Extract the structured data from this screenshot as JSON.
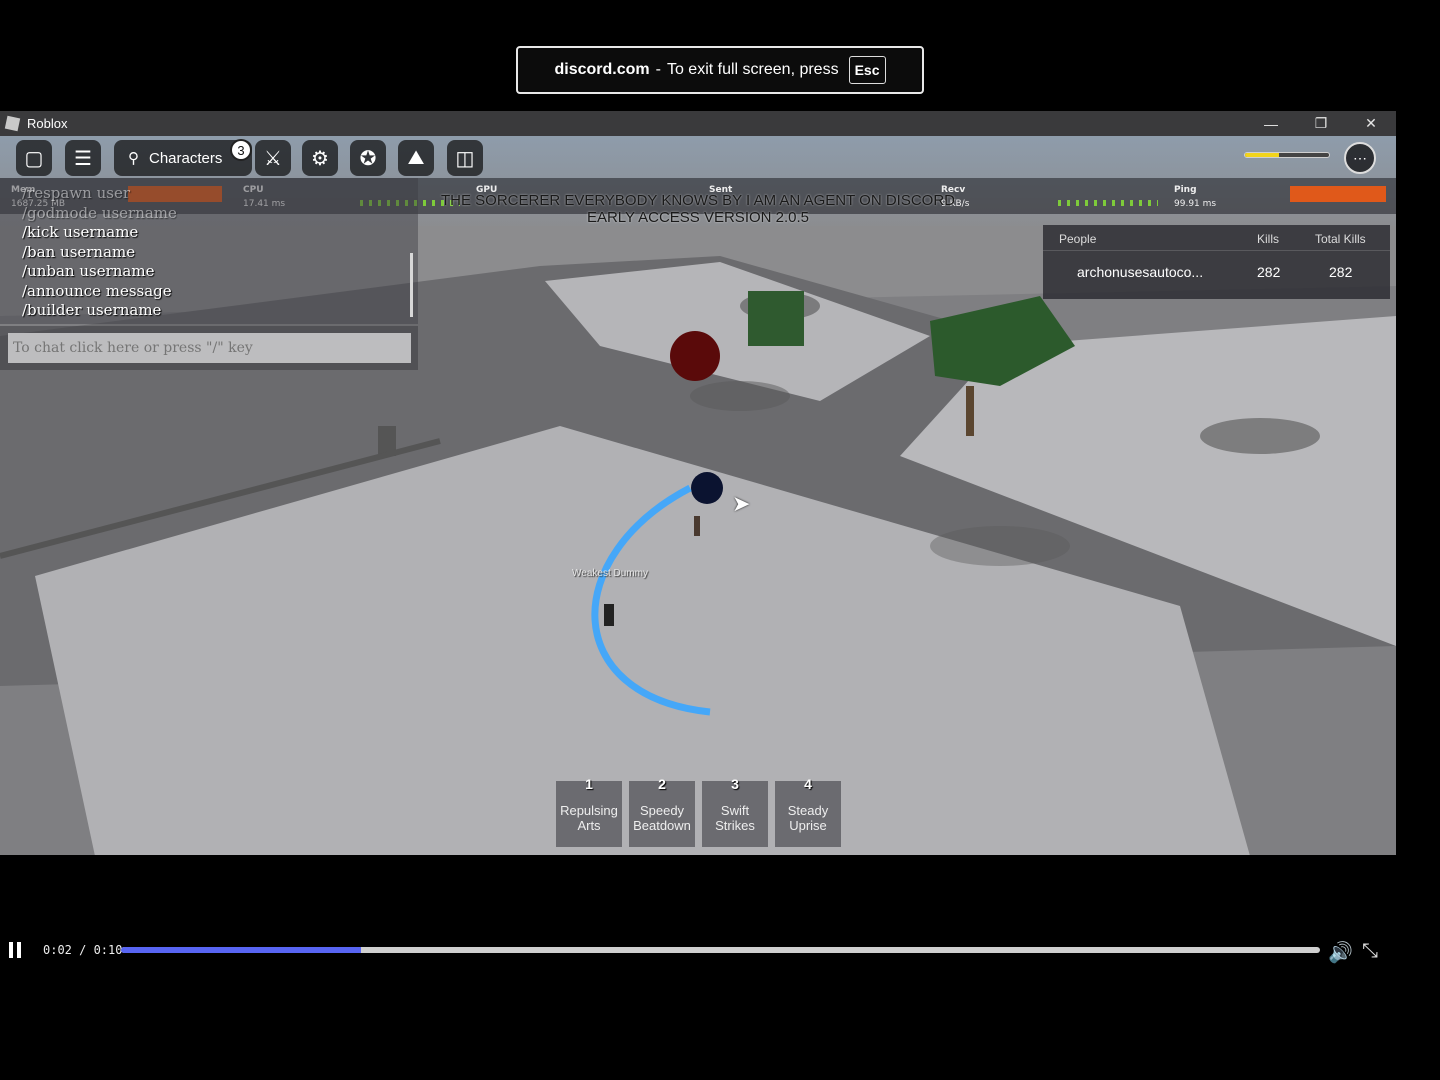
{
  "fullscreen_notice": {
    "domain": "discord.com",
    "text": "To exit full screen, press",
    "key": "Esc"
  },
  "window": {
    "title": "Roblox",
    "controls": [
      "minimize",
      "restore",
      "close"
    ]
  },
  "topbar": {
    "characters_label": "Characters",
    "characters_badge": "3",
    "health_fraction": 0.4
  },
  "stats": {
    "mem_label": "Mem",
    "mem_value": "1687.25 MB",
    "cpu_label": "CPU",
    "cpu_value": "17.41 ms",
    "gpu_label": "GPU",
    "sent_label": "Sent",
    "recv_label": "Recv",
    "recv_value": "9 KB/s",
    "ping_label": "Ping",
    "ping_value": "99.91 ms"
  },
  "banner": {
    "line1": "THE SORCERER EVERYBODY KNOWS BY I AM AN AGENT ON DISCORD",
    "line2": "EARLY ACCESS VERSION 2.0.5"
  },
  "commands": {
    "lines": [
      "/respawn user",
      "/godmode username",
      "/kick username",
      "/ban username",
      "/unban username",
      "/announce message",
      "/builder username"
    ]
  },
  "chat": {
    "placeholder": "To chat click here or press \"/\" key"
  },
  "leaderboard": {
    "headers": {
      "people": "People",
      "kills": "Kills",
      "total_kills": "Total Kills"
    },
    "rows": [
      {
        "name": "archonusesautoco...",
        "kills": "282",
        "total_kills": "282"
      }
    ]
  },
  "world": {
    "npc_label": "Weakest Dummy"
  },
  "hotbar": [
    {
      "num": "1",
      "line1": "Repulsing",
      "line2": "Arts"
    },
    {
      "num": "2",
      "line1": "Speedy",
      "line2": "Beatdown"
    },
    {
      "num": "3",
      "line1": "Swift",
      "line2": "Strikes"
    },
    {
      "num": "4",
      "line1": "Steady",
      "line2": "Uprise"
    }
  ],
  "video": {
    "time": "0:02 / 0:10",
    "progress_fraction": 0.2
  },
  "colors": {
    "accent": "#5865f2",
    "stat_bar": "#e0591a",
    "health": "#f2d41c"
  }
}
